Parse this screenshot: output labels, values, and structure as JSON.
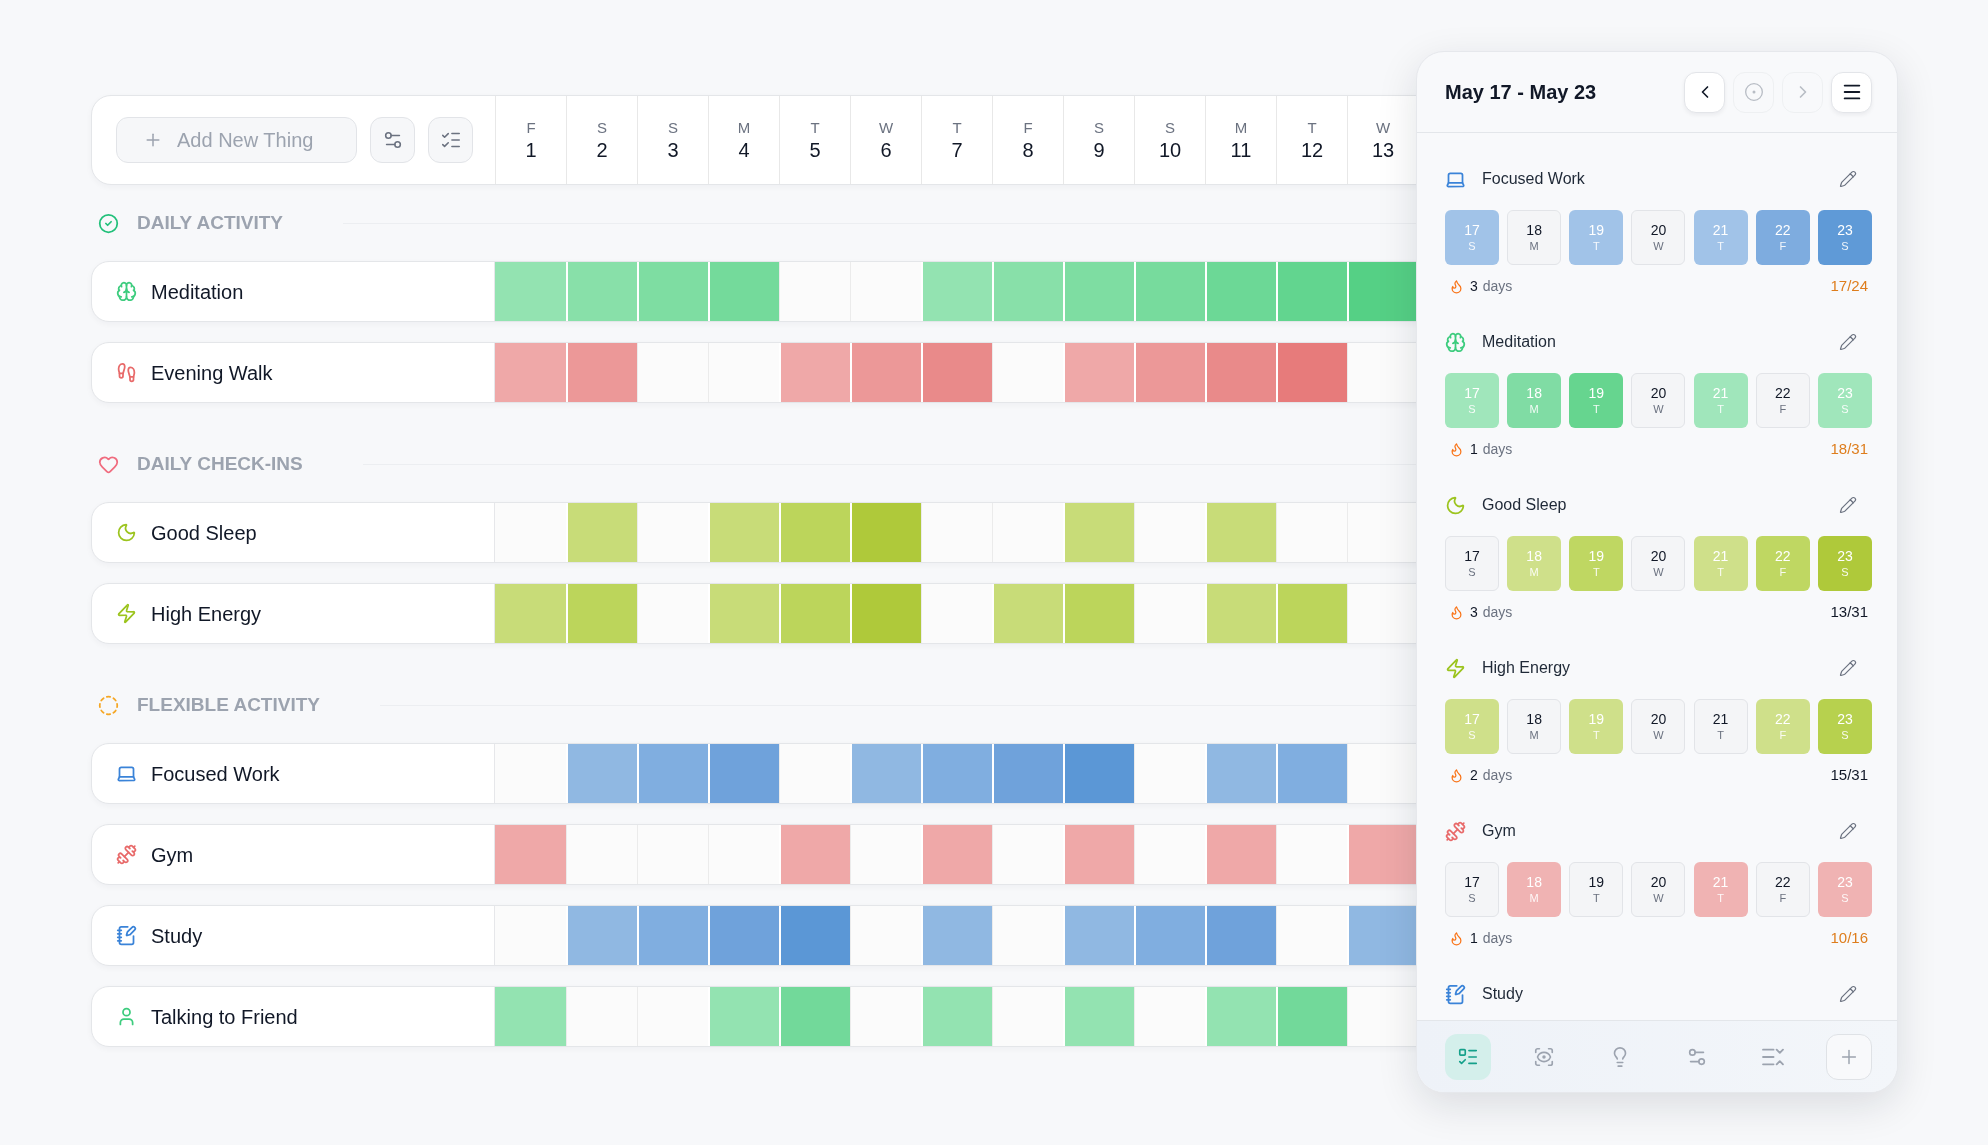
{
  "toolbar": {
    "add_button": "Add New Thing"
  },
  "days": [
    {
      "weekday": "F",
      "day": "1"
    },
    {
      "weekday": "S",
      "day": "2"
    },
    {
      "weekday": "S",
      "day": "3"
    },
    {
      "weekday": "M",
      "day": "4"
    },
    {
      "weekday": "T",
      "day": "5"
    },
    {
      "weekday": "W",
      "day": "6"
    },
    {
      "weekday": "T",
      "day": "7"
    },
    {
      "weekday": "F",
      "day": "8"
    },
    {
      "weekday": "S",
      "day": "9"
    },
    {
      "weekday": "S",
      "day": "10"
    },
    {
      "weekday": "M",
      "day": "11"
    },
    {
      "weekday": "T",
      "day": "12"
    },
    {
      "weekday": "W",
      "day": "13"
    }
  ],
  "sections": [
    {
      "title": "DAILY ACTIVITY",
      "color": "#22c07a",
      "habits": [
        {
          "name": "Meditation",
          "color": "#3dcc7e",
          "cells": [
            {
              "done": true,
              "color": "#93e3b1"
            },
            {
              "done": true,
              "color": "#88e0a9"
            },
            {
              "done": true,
              "color": "#7edda2"
            },
            {
              "done": true,
              "color": "#74da9b"
            },
            {
              "done": false
            },
            {
              "done": false
            },
            {
              "done": true,
              "color": "#93e3b1"
            },
            {
              "done": true,
              "color": "#88e0a9"
            },
            {
              "done": true,
              "color": "#7edda2"
            },
            {
              "done": true,
              "color": "#77db9d"
            },
            {
              "done": true,
              "color": "#6cd896"
            },
            {
              "done": true,
              "color": "#62d58f"
            },
            {
              "done": true,
              "color": "#55d085"
            }
          ]
        },
        {
          "name": "Evening Walk",
          "color": "#e86a6a",
          "cells": [
            {
              "done": true,
              "color": "#efa8a8"
            },
            {
              "done": true,
              "color": "#ec9898"
            },
            {
              "done": false
            },
            {
              "done": false
            },
            {
              "done": true,
              "color": "#efa8a8"
            },
            {
              "done": true,
              "color": "#ec9898"
            },
            {
              "done": true,
              "color": "#e98a8a"
            },
            {
              "done": false
            },
            {
              "done": true,
              "color": "#efa8a8"
            },
            {
              "done": true,
              "color": "#ec9898"
            },
            {
              "done": true,
              "color": "#e98a8a"
            },
            {
              "done": true,
              "color": "#e77b7b"
            },
            {
              "done": false
            }
          ]
        }
      ]
    },
    {
      "title": "DAILY CHECK-INS",
      "color": "#f06b7e",
      "habits": [
        {
          "name": "Good Sleep",
          "color": "#9cc41e",
          "cells": [
            {
              "done": false
            },
            {
              "done": true,
              "color": "#c8dc78"
            },
            {
              "done": false
            },
            {
              "done": true,
              "color": "#c8dc78"
            },
            {
              "done": true,
              "color": "#bcd55b"
            },
            {
              "done": true,
              "color": "#afc93a"
            },
            {
              "done": false
            },
            {
              "done": false
            },
            {
              "done": true,
              "color": "#c8dc78"
            },
            {
              "done": false
            },
            {
              "done": true,
              "color": "#c8dc78"
            },
            {
              "done": false
            },
            {
              "done": false
            }
          ]
        },
        {
          "name": "High Energy",
          "color": "#9cc41e",
          "cells": [
            {
              "done": true,
              "color": "#c8dc78"
            },
            {
              "done": true,
              "color": "#bcd55b"
            },
            {
              "done": false
            },
            {
              "done": true,
              "color": "#c8dc78"
            },
            {
              "done": true,
              "color": "#bcd55b"
            },
            {
              "done": true,
              "color": "#afc93a"
            },
            {
              "done": false
            },
            {
              "done": true,
              "color": "#c8dc78"
            },
            {
              "done": true,
              "color": "#bcd55b"
            },
            {
              "done": false
            },
            {
              "done": true,
              "color": "#c8dc78"
            },
            {
              "done": true,
              "color": "#bcd55b"
            },
            {
              "done": false
            }
          ]
        }
      ]
    },
    {
      "title": "FLEXIBLE ACTIVITY",
      "color": "#f5a623",
      "habits": [
        {
          "name": "Focused Work",
          "color": "#3a83d8",
          "cells": [
            {
              "done": false
            },
            {
              "done": true,
              "color": "#90b8e2"
            },
            {
              "done": true,
              "color": "#80aee0"
            },
            {
              "done": true,
              "color": "#6fa2db"
            },
            {
              "done": false
            },
            {
              "done": true,
              "color": "#90b8e2"
            },
            {
              "done": true,
              "color": "#80aee0"
            },
            {
              "done": true,
              "color": "#6fa2db"
            },
            {
              "done": true,
              "color": "#5b97d6"
            },
            {
              "done": false
            },
            {
              "done": true,
              "color": "#90b8e2"
            },
            {
              "done": true,
              "color": "#80aee0"
            },
            {
              "done": false
            }
          ]
        },
        {
          "name": "Gym",
          "color": "#e86a6a",
          "cells": [
            {
              "done": true,
              "color": "#efa8a8"
            },
            {
              "done": false
            },
            {
              "done": false
            },
            {
              "done": false
            },
            {
              "done": true,
              "color": "#efa8a8"
            },
            {
              "done": false
            },
            {
              "done": true,
              "color": "#efa8a8"
            },
            {
              "done": false
            },
            {
              "done": true,
              "color": "#efa8a8"
            },
            {
              "done": false
            },
            {
              "done": true,
              "color": "#efa8a8"
            },
            {
              "done": false
            },
            {
              "done": true,
              "color": "#efa8a8"
            }
          ]
        },
        {
          "name": "Study",
          "color": "#3a83d8",
          "cells": [
            {
              "done": false
            },
            {
              "done": true,
              "color": "#90b8e2"
            },
            {
              "done": true,
              "color": "#80aee0"
            },
            {
              "done": true,
              "color": "#6fa2db"
            },
            {
              "done": true,
              "color": "#5b97d6"
            },
            {
              "done": false
            },
            {
              "done": true,
              "color": "#90b8e2"
            },
            {
              "done": false
            },
            {
              "done": true,
              "color": "#90b8e2"
            },
            {
              "done": true,
              "color": "#80aee0"
            },
            {
              "done": true,
              "color": "#6fa2db"
            },
            {
              "done": false
            },
            {
              "done": true,
              "color": "#90b8e2"
            }
          ]
        },
        {
          "name": "Talking to Friend",
          "color": "#3dcc7e",
          "cells": [
            {
              "done": true,
              "color": "#93e3b1"
            },
            {
              "done": false
            },
            {
              "done": false
            },
            {
              "done": true,
              "color": "#93e3b1"
            },
            {
              "done": true,
              "color": "#72d99a"
            },
            {
              "done": false
            },
            {
              "done": true,
              "color": "#93e3b1"
            },
            {
              "done": false
            },
            {
              "done": true,
              "color": "#93e3b1"
            },
            {
              "done": false
            },
            {
              "done": true,
              "color": "#93e3b1"
            },
            {
              "done": true,
              "color": "#72d99a"
            },
            {
              "done": false
            }
          ]
        }
      ]
    }
  ],
  "panel": {
    "title": "May 17 - May 23",
    "prev_button": {
      "disabled": false
    },
    "today_button": {
      "disabled": true
    },
    "next_button": {
      "disabled": true
    },
    "habits": [
      {
        "name": "Focused Work",
        "color": "#3a83d8",
        "days": [
          {
            "day": "17",
            "weekday": "S",
            "done": true,
            "color": "#a1c3e8"
          },
          {
            "day": "18",
            "weekday": "M",
            "done": false
          },
          {
            "day": "19",
            "weekday": "T",
            "done": true,
            "color": "#a1c3e8"
          },
          {
            "day": "20",
            "weekday": "W",
            "done": false
          },
          {
            "day": "21",
            "weekday": "T",
            "done": true,
            "color": "#a1c3e8"
          },
          {
            "day": "22",
            "weekday": "F",
            "done": true,
            "color": "#7eacdf"
          },
          {
            "day": "23",
            "weekday": "S",
            "done": true,
            "color": "#5f9ad7"
          }
        ],
        "streak_value": "3",
        "streak_unit": "days",
        "count": {
          "text": "17/24",
          "color": "#de7d1c"
        }
      },
      {
        "name": "Meditation",
        "color": "#3dcc7e",
        "days": [
          {
            "day": "17",
            "weekday": "S",
            "done": true,
            "color": "#a0e6bb"
          },
          {
            "day": "18",
            "weekday": "M",
            "done": true,
            "color": "#80dca4"
          },
          {
            "day": "19",
            "weekday": "T",
            "done": true,
            "color": "#66d58f"
          },
          {
            "day": "20",
            "weekday": "W",
            "done": false
          },
          {
            "day": "21",
            "weekday": "T",
            "done": true,
            "color": "#a0e6bb"
          },
          {
            "day": "22",
            "weekday": "F",
            "done": false
          },
          {
            "day": "23",
            "weekday": "S",
            "done": true,
            "color": "#a0e6bb"
          }
        ],
        "streak_value": "1",
        "streak_unit": "days",
        "count": {
          "text": "18/31",
          "color": "#de7d1c"
        }
      },
      {
        "name": "Good Sleep",
        "color": "#9cc41e",
        "days": [
          {
            "day": "17",
            "weekday": "S",
            "done": false
          },
          {
            "day": "18",
            "weekday": "M",
            "done": true,
            "color": "#cfe08a"
          },
          {
            "day": "19",
            "weekday": "T",
            "done": true,
            "color": "#bfd762"
          },
          {
            "day": "20",
            "weekday": "W",
            "done": false
          },
          {
            "day": "21",
            "weekday": "T",
            "done": true,
            "color": "#cfe08a"
          },
          {
            "day": "22",
            "weekday": "F",
            "done": true,
            "color": "#bfd762"
          },
          {
            "day": "23",
            "weekday": "S",
            "done": true,
            "color": "#afc93a"
          }
        ],
        "streak_value": "3",
        "streak_unit": "days",
        "count": {
          "text": "13/31",
          "color": "#111827"
        }
      },
      {
        "name": "High Energy",
        "color": "#9cc41e",
        "days": [
          {
            "day": "17",
            "weekday": "S",
            "done": true,
            "color": "#cfe08a"
          },
          {
            "day": "18",
            "weekday": "M",
            "done": false
          },
          {
            "day": "19",
            "weekday": "T",
            "done": true,
            "color": "#cfe08a"
          },
          {
            "day": "20",
            "weekday": "W",
            "done": false
          },
          {
            "day": "21",
            "weekday": "T",
            "done": false
          },
          {
            "day": "22",
            "weekday": "F",
            "done": true,
            "color": "#cfe08a"
          },
          {
            "day": "23",
            "weekday": "S",
            "done": true,
            "color": "#b7d14e"
          }
        ],
        "streak_value": "2",
        "streak_unit": "days",
        "count": {
          "text": "15/31",
          "color": "#111827"
        }
      },
      {
        "name": "Gym",
        "color": "#e86a6a",
        "days": [
          {
            "day": "17",
            "weekday": "S",
            "done": false
          },
          {
            "day": "18",
            "weekday": "M",
            "done": true,
            "color": "#f0b3b3"
          },
          {
            "day": "19",
            "weekday": "T",
            "done": false
          },
          {
            "day": "20",
            "weekday": "W",
            "done": false
          },
          {
            "day": "21",
            "weekday": "T",
            "done": true,
            "color": "#f0b3b3"
          },
          {
            "day": "22",
            "weekday": "F",
            "done": false
          },
          {
            "day": "23",
            "weekday": "S",
            "done": true,
            "color": "#f0b3b3"
          }
        ],
        "streak_value": "1",
        "streak_unit": "days",
        "count": {
          "text": "10/16",
          "color": "#de7d1c"
        }
      },
      {
        "name": "Study",
        "color": "#3a83d8"
      }
    ],
    "nav": [
      {
        "selected": true
      },
      {
        "selected": false
      },
      {
        "selected": false
      },
      {
        "selected": false
      },
      {
        "selected": false
      }
    ]
  }
}
